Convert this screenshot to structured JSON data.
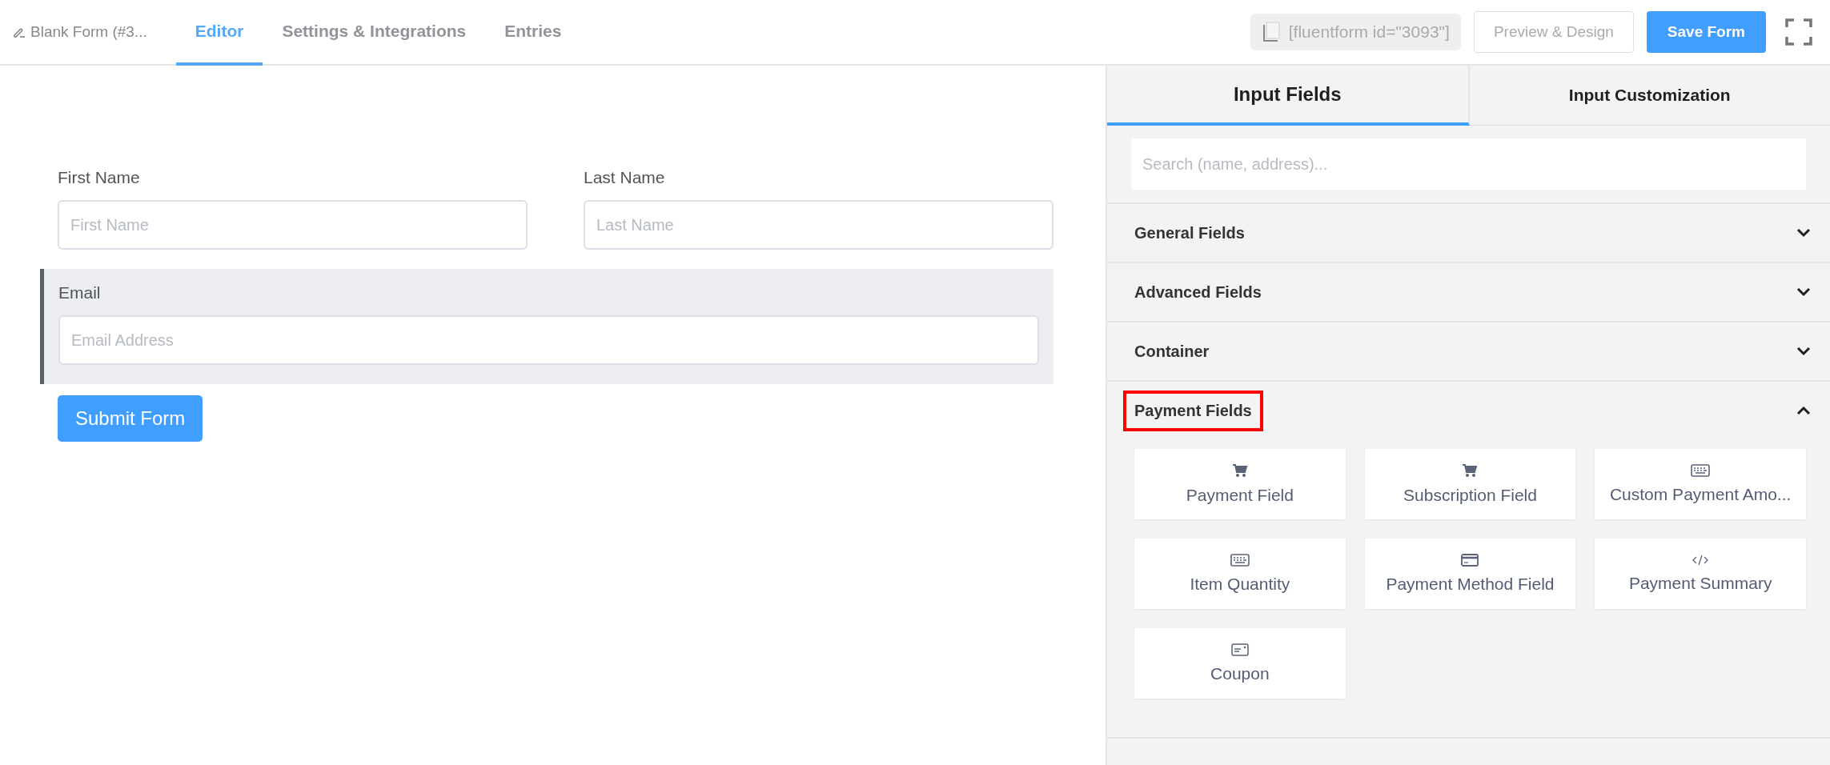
{
  "header": {
    "form_title": "Blank Form (#3...",
    "tabs": [
      {
        "label": "Editor",
        "selected": true
      },
      {
        "label": "Settings & Integrations",
        "selected": false
      },
      {
        "label": "Entries",
        "selected": false
      }
    ],
    "shortcode": "[fluentform id=\"3093\"]",
    "preview_button": "Preview & Design",
    "save_button": "Save Form"
  },
  "form": {
    "rows": [
      {
        "fields": [
          {
            "label": "First Name",
            "placeholder": "First Name",
            "selected": false
          },
          {
            "label": "Last Name",
            "placeholder": "Last Name",
            "selected": false
          }
        ]
      },
      {
        "fields": [
          {
            "label": "Email",
            "placeholder": "Email Address",
            "selected": true
          }
        ]
      }
    ],
    "submit_button": "Submit Form"
  },
  "sidebar": {
    "tabs": [
      {
        "label": "Input Fields",
        "selected": true
      },
      {
        "label": "Input Customization",
        "selected": false
      }
    ],
    "search": {
      "placeholder": "Search (name, address)..."
    },
    "sections": [
      {
        "title": "General Fields",
        "expanded": false,
        "highlighted": false
      },
      {
        "title": "Advanced Fields",
        "expanded": false,
        "highlighted": false
      },
      {
        "title": "Container",
        "expanded": false,
        "highlighted": false
      },
      {
        "title": "Payment Fields",
        "expanded": true,
        "highlighted": true,
        "items": [
          {
            "label": "Payment Field",
            "kind": "cart"
          },
          {
            "label": "Subscription Field",
            "kind": "cart"
          },
          {
            "label": "Custom Payment Amo...",
            "kind": "keyboard"
          },
          {
            "label": "Item Quantity",
            "kind": "keyboard"
          },
          {
            "label": "Payment Method Field",
            "kind": "card"
          },
          {
            "label": "Payment Summary",
            "kind": "code"
          },
          {
            "label": "Coupon",
            "kind": "coupon"
          }
        ]
      }
    ]
  }
}
